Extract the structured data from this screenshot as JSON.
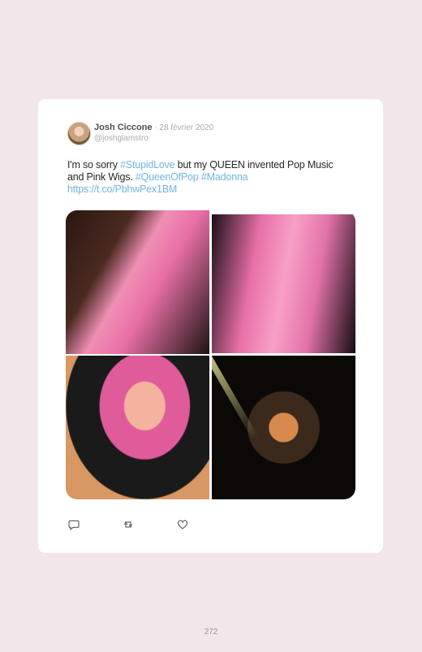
{
  "tweet": {
    "author_name": "Josh Ciccone",
    "date": " · 28 février 2020",
    "handle": "@joshglamstro",
    "text_1": "I'm so sorry ",
    "tag_1": "#StupidLove",
    "text_2": " but my QUEEN invented Pop Music and Pink Wigs. ",
    "tag_2": "#QueenOfPop",
    "tag_3": "#Madonna",
    "link": "https://t.co/PbhwPex1BM"
  },
  "icons": {
    "reply": "comment-icon",
    "retweet": "retweet-icon",
    "like": "heart-icon"
  },
  "colors": {
    "background": "#f3e6ea",
    "card": "#ffffff",
    "link": "#6fb6e3"
  },
  "page_number": "272"
}
